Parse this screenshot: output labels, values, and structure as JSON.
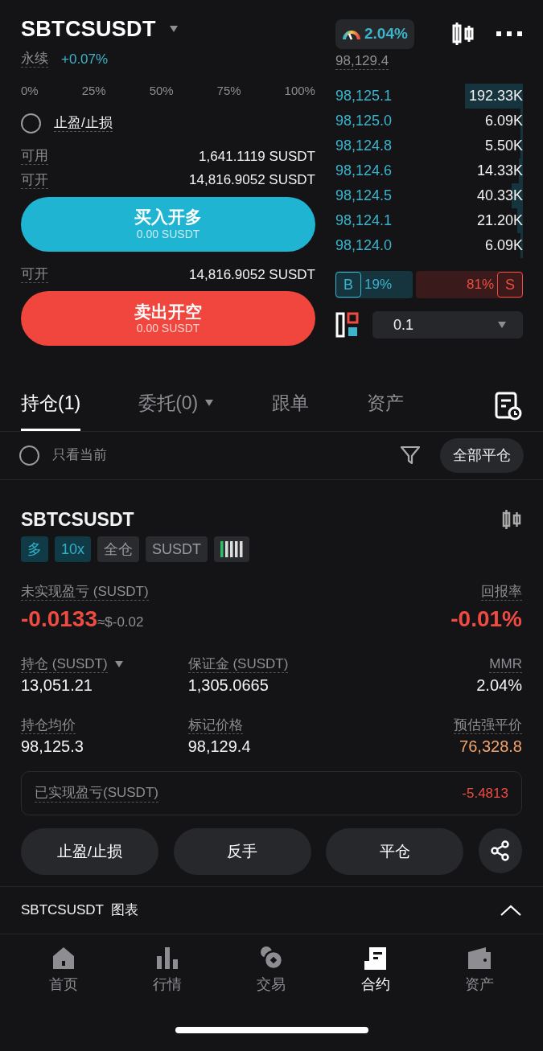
{
  "header": {
    "symbol": "SBTCSUSDT",
    "type": "永续",
    "change": "+0.07%",
    "funding_rate": "2.04%"
  },
  "last_price": "98,129.4",
  "percent_marks": [
    "0%",
    "25%",
    "50%",
    "75%",
    "100%"
  ],
  "tpsl": {
    "label": "止盈/止损",
    "checked": false
  },
  "available": {
    "label": "可用",
    "value": "1,641.1119 SUSDT"
  },
  "long_open": {
    "label": "可开",
    "value": "14,816.9052 SUSDT"
  },
  "buy_button": {
    "label": "买入开多",
    "amount": "0.00 SUSDT"
  },
  "short_open": {
    "label": "可开",
    "value": "14,816.9052 SUSDT"
  },
  "sell_button": {
    "label": "卖出开空",
    "amount": "0.00 SUSDT"
  },
  "order_book": [
    {
      "price": "98,125.1",
      "size": "192.33K"
    },
    {
      "price": "98,125.0",
      "size": "6.09K"
    },
    {
      "price": "98,124.8",
      "size": "5.50K"
    },
    {
      "price": "98,124.6",
      "size": "14.33K"
    },
    {
      "price": "98,124.5",
      "size": "40.33K"
    },
    {
      "price": "98,124.1",
      "size": "21.20K"
    },
    {
      "price": "98,124.0",
      "size": "6.09K"
    }
  ],
  "ratio": {
    "buy_label": "B",
    "buy": "19%",
    "sell": "81%",
    "sell_label": "S"
  },
  "precision": "0.1",
  "tabs": [
    {
      "label": "持仓(1)",
      "selected": true,
      "dropdown": false
    },
    {
      "label": "委托(0)",
      "selected": false,
      "dropdown": true
    },
    {
      "label": "跟单",
      "selected": false,
      "dropdown": false
    },
    {
      "label": "资产",
      "selected": false,
      "dropdown": false
    }
  ],
  "filter": {
    "label": "只看当前",
    "checked": false
  },
  "close_all": "全部平仓",
  "position": {
    "symbol": "SBTCSUSDT",
    "tags": [
      {
        "kind": "accent",
        "label": "多"
      },
      {
        "kind": "accent",
        "label": "10x"
      },
      {
        "kind": "plain",
        "label": "全仓"
      },
      {
        "kind": "plain",
        "label": "SUSDT"
      },
      {
        "kind": "adl",
        "level": 0.2
      }
    ],
    "unrealized": {
      "label": "未实现盈亏 (SUSDT)",
      "value": "-0.0133",
      "approx": "≈$-0.02"
    },
    "roe": {
      "label": "回报率",
      "value": "-0.01%"
    },
    "stats": [
      {
        "label": "持仓 (SUSDT)",
        "value": "13,051.21",
        "dropdown": true,
        "kind": "normal"
      },
      {
        "label": "保证金 (SUSDT)",
        "value": "1,305.0665",
        "dropdown": false,
        "kind": "normal"
      },
      {
        "label": "MMR",
        "value": "2.04%",
        "dropdown": false,
        "kind": "normal"
      },
      {
        "label": "持仓均价",
        "value": "98,125.3",
        "dropdown": false,
        "kind": "normal"
      },
      {
        "label": "标记价格",
        "value": "98,129.4",
        "dropdown": false,
        "kind": "normal"
      },
      {
        "label": "预估强平价",
        "value": "76,328.8",
        "dropdown": false,
        "kind": "warning"
      }
    ],
    "realized": {
      "label": "已实现盈亏(SUSDT)",
      "value": "-5.4813"
    },
    "actions": [
      "止盈/止损",
      "反手",
      "平仓"
    ]
  },
  "chart_section": {
    "label": "SBTCSUSDT  图表",
    "expanded": true
  },
  "nav": [
    {
      "kind": "home",
      "label": "首页",
      "selected": false
    },
    {
      "kind": "market",
      "label": "行情",
      "selected": false
    },
    {
      "kind": "trade",
      "label": "交易",
      "selected": false
    },
    {
      "kind": "contract",
      "label": "合约",
      "selected": true
    },
    {
      "kind": "assets",
      "label": "资产",
      "selected": false
    }
  ]
}
